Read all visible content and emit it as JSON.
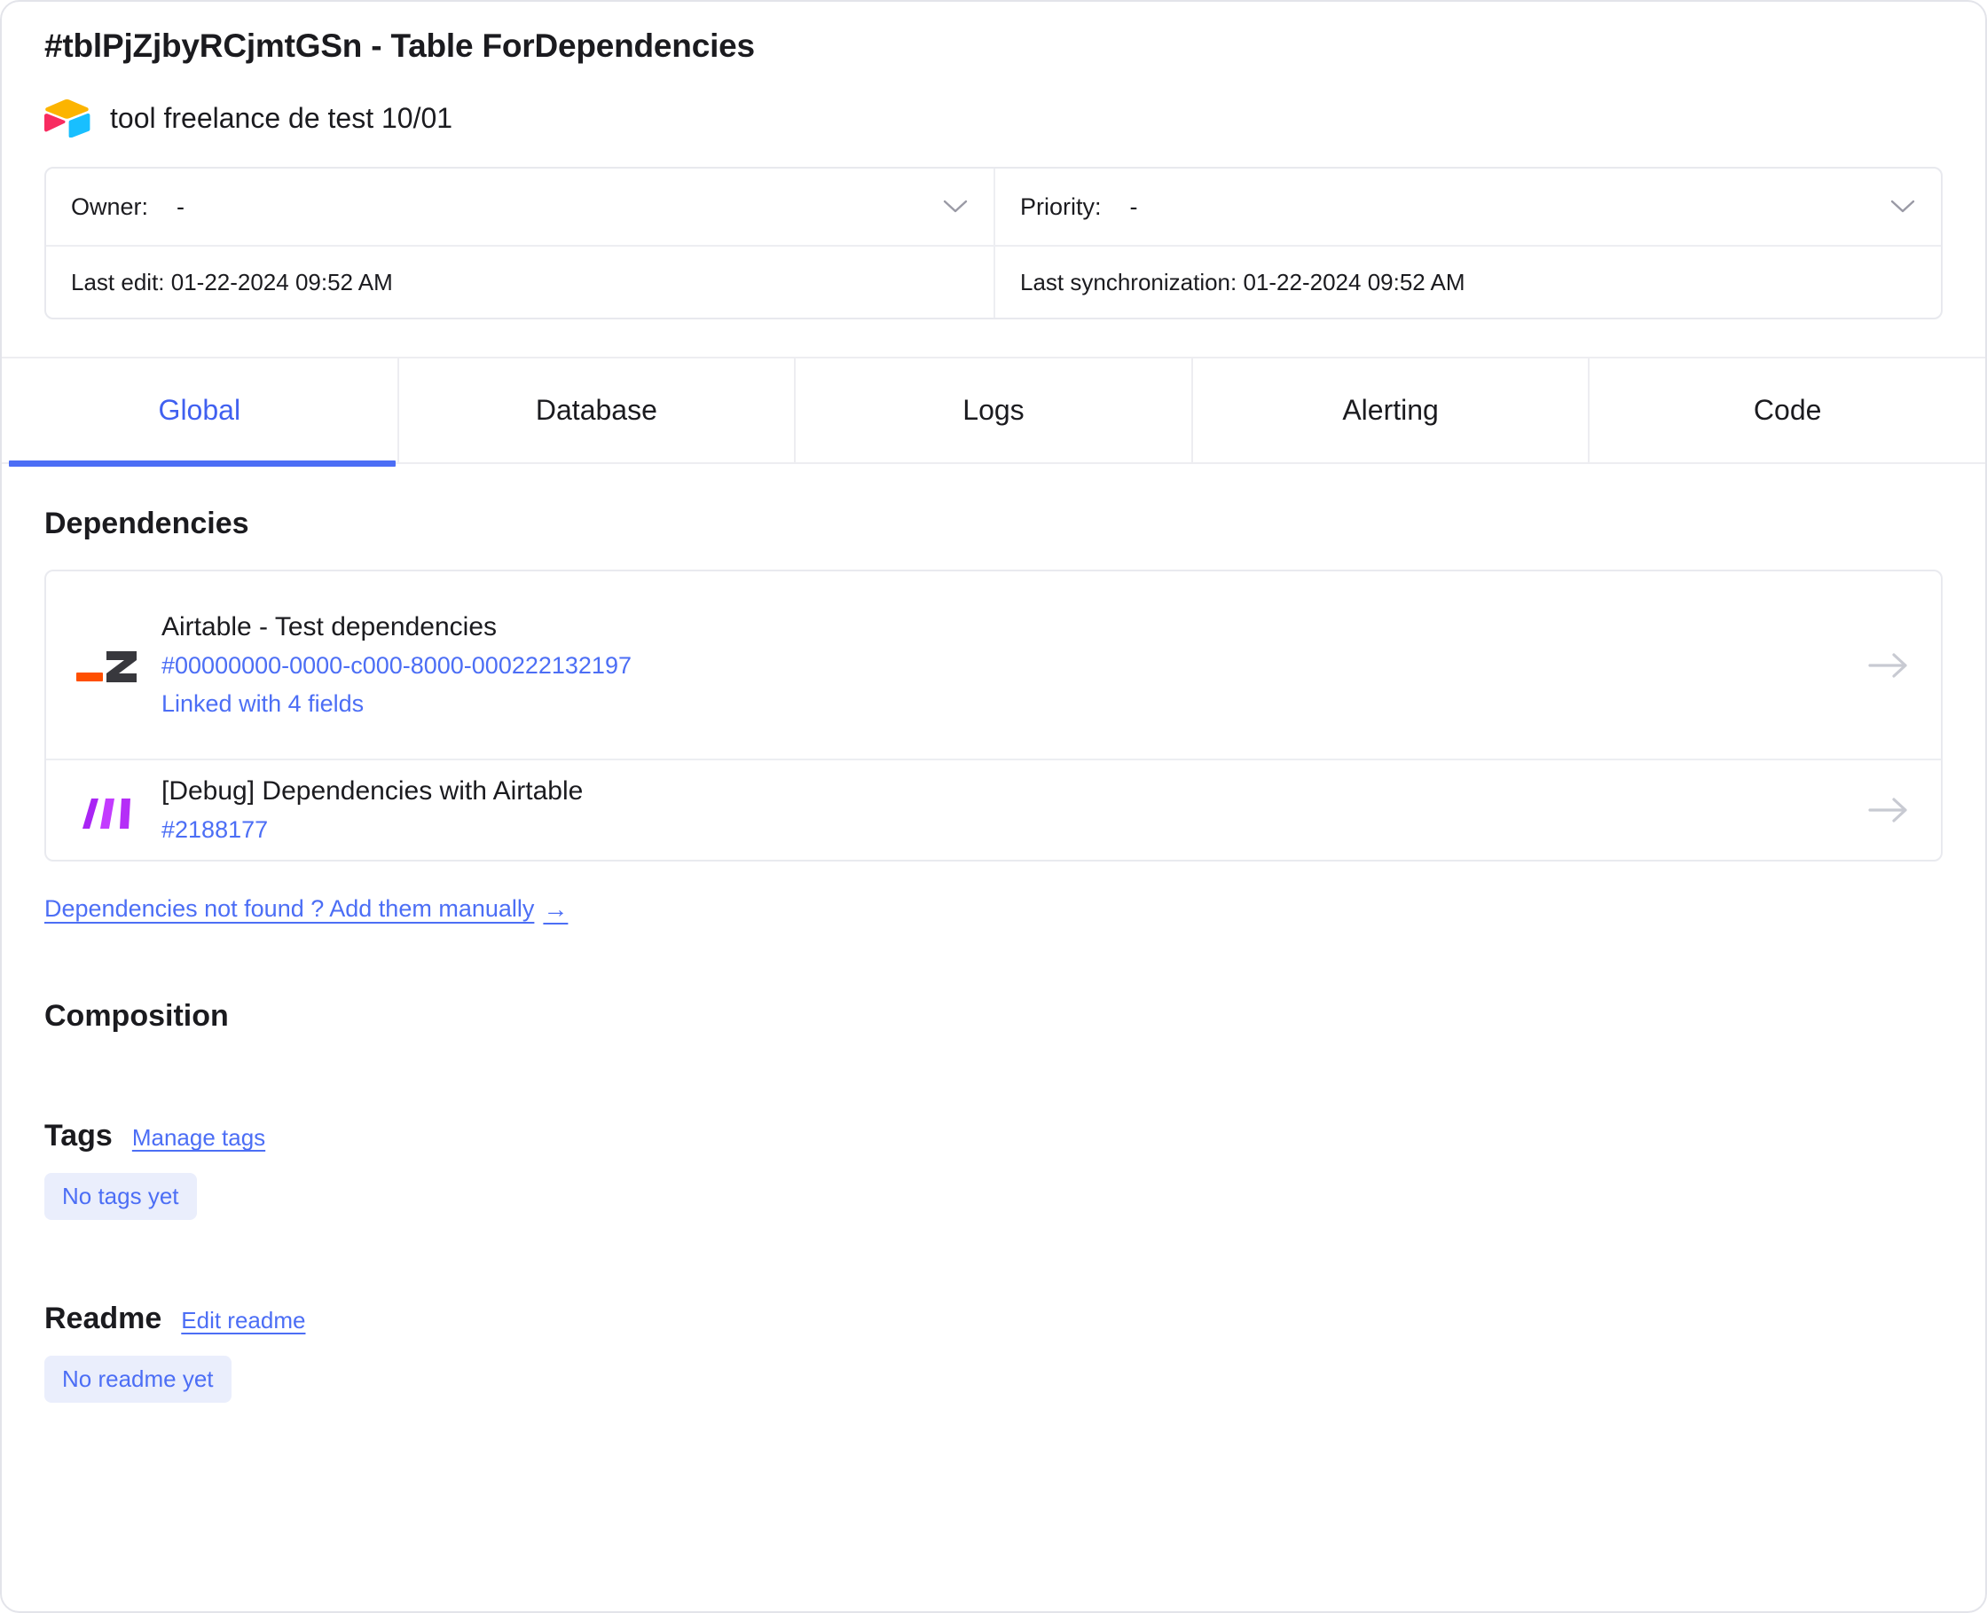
{
  "header": {
    "title": "#tblPjZjbyRCjmtGSn - Table ForDependencies",
    "app_icon": "airtable-logo",
    "app_name": "tool freelance de test 10/01"
  },
  "meta": {
    "owner_label": "Owner:",
    "owner_value": "-",
    "priority_label": "Priority:",
    "priority_value": "-",
    "last_edit": "Last edit: 01-22-2024 09:52 AM",
    "last_sync": "Last synchronization: 01-22-2024 09:52 AM",
    "chevron_icon": "chevron-down-icon"
  },
  "tabs": [
    {
      "label": "Global",
      "active": true
    },
    {
      "label": "Database",
      "active": false
    },
    {
      "label": "Logs",
      "active": false
    },
    {
      "label": "Alerting",
      "active": false
    },
    {
      "label": "Code",
      "active": false
    }
  ],
  "dependencies": {
    "title": "Dependencies",
    "items": [
      {
        "icon": "zapier-z-logo-icon",
        "name": "Airtable - Test dependencies",
        "id": "#00000000-0000-c000-8000-000222132197",
        "sub": "Linked with 4 fields",
        "arrow_icon": "arrow-right-icon"
      },
      {
        "icon": "monday-logo-icon",
        "name": "[Debug] Dependencies with Airtable",
        "id": "#2188177",
        "sub": "",
        "arrow_icon": "arrow-right-icon"
      }
    ],
    "manual_link": "Dependencies not found ? Add them manually",
    "manual_link_arrow": "→"
  },
  "composition": {
    "title": "Composition"
  },
  "tags": {
    "title": "Tags",
    "manage_link": "Manage tags",
    "empty": "No tags yet"
  },
  "readme": {
    "title": "Readme",
    "edit_link": "Edit readme",
    "empty": "No readme yet"
  },
  "colors": {
    "accent": "#4c6ef5",
    "text": "#1b1b1f",
    "border": "#e9eaef",
    "pill_bg": "#eaeefc",
    "zapier_orange": "#ff4f00",
    "monday_purple": "#a925f4"
  }
}
